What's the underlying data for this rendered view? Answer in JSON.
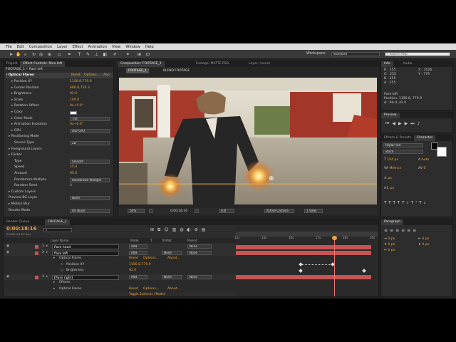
{
  "menu": [
    "File",
    "Edit",
    "Composition",
    "Layer",
    "Effect",
    "Animation",
    "View",
    "Window",
    "Help"
  ],
  "toolbar": {
    "workspace_label": "Workspace:",
    "workspace_value": "Standard",
    "search_placeholder": "Search Help"
  },
  "left_panel": {
    "tabs": [
      "Project",
      "Effect Controls: flare left"
    ],
    "breadcrumb": "FOOTAGE_1 • flare left",
    "effect_name": "Optical Flares",
    "effect_links": [
      "Reset",
      "Options...",
      "Abo"
    ],
    "properties": [
      {
        "label": "Position XY",
        "value": "1156.8,779.9",
        "indent": 2
      },
      {
        "label": "Center Position",
        "value": "668.8,759.3",
        "indent": 2
      },
      {
        "label": "Brightness",
        "value": "92.0",
        "indent": 2
      },
      {
        "label": "Scale",
        "value": "100.0",
        "indent": 2
      },
      {
        "label": "Rotation Offset",
        "value": "0x+0.0°",
        "indent": 2
      },
      {
        "label": "Color",
        "value": "",
        "indent": 2
      },
      {
        "label": "Color Mode",
        "value": "Tint",
        "indent": 2
      },
      {
        "label": "Animation Evolution",
        "value": "0x+0.0°",
        "indent": 2
      },
      {
        "label": "GPU",
        "value": "Use GPU",
        "indent": 2
      },
      {
        "label": "Positioning Mode",
        "value": "",
        "indent": 1
      },
      {
        "label": "Source Type",
        "value": "2D",
        "indent": 3
      },
      {
        "label": "Foreground Layers",
        "value": "",
        "indent": 1
      },
      {
        "label": "Flicker",
        "value": "",
        "indent": 1
      },
      {
        "label": "Type",
        "value": "Smooth",
        "indent": 3
      },
      {
        "label": "Speed",
        "value": "15.0",
        "indent": 3
      },
      {
        "label": "Amount",
        "value": "95.0",
        "indent": 3
      },
      {
        "label": "Randomize Multiple",
        "value": "Randomize Multiple",
        "indent": 3
      },
      {
        "label": "Random Seed",
        "value": "0",
        "indent": 3
      },
      {
        "label": "Custom Layers",
        "value": "",
        "indent": 1
      },
      {
        "label": "Preview BG Layer",
        "value": "None",
        "indent": 1
      },
      {
        "label": "Motion Blur",
        "value": "",
        "indent": 1
      },
      {
        "label": "Render Mode",
        "value": "On Black",
        "indent": 1
      }
    ]
  },
  "viewer": {
    "tabs": [
      "Composition: FOOTAGE_1",
      "Footage: MATTE.PSD",
      "Layer: (none)"
    ],
    "nav_crumbs": [
      "FOOTAGE_1",
      "BLEND FOOTAGE"
    ],
    "zoom": "50%",
    "timecode": "0;00;18;16",
    "resolution": "Full",
    "camera": "Active Camera",
    "views": "1 View"
  },
  "right_panel": {
    "info_tabs": [
      "Info",
      "Audio"
    ],
    "info_lines": [
      "R : 255",
      "G : 255",
      "B : 255",
      "A : 255"
    ],
    "info_coords": [
      "X : 1026",
      "Y : 779"
    ],
    "info_layer": "flare left",
    "info_position": "Position: 1156.8, 779.9",
    "info_delta": "Δ: -96.0, 42.0",
    "preview_tab": "Preview",
    "effects_tab": "Effects & Presets",
    "character_tab": "Character",
    "font_name": "Poplar Std",
    "font_style": "Black",
    "font_size": "104 px",
    "leading": "Auto",
    "tracking": "0",
    "kerning": "Metrics",
    "px_values": [
      "px",
      "px"
    ],
    "paragraph_tab": "Paragraph",
    "para_values": [
      "0 px",
      "0 px",
      "0 px",
      "0 px",
      "0 px"
    ]
  },
  "timeline": {
    "tabs": [
      "Render Queue",
      "FOOTAGE_1"
    ],
    "current_time": "0:00:18:16",
    "frame_info": "00496 (29.97 fps)",
    "columns": [
      "Layer Name",
      "Mode",
      "T",
      "TrkMat",
      "Parent"
    ],
    "rulers": [
      "12s",
      "14s",
      "16s",
      "17s",
      "18s",
      "20s"
    ],
    "toggle_label": "Toggle Switches / Modes",
    "rows": [
      {
        "num": "1",
        "name": "flare head",
        "mode": "Add",
        "trk": "",
        "parent": "None",
        "kind": "layer"
      },
      {
        "num": "2",
        "name": "flare left",
        "mode": "Add",
        "trk": "None",
        "parent": "None",
        "kind": "layer"
      },
      {
        "num": "",
        "name": "Optical Flares",
        "mode": "Reset",
        "trk": "Options...",
        "parent": "About...",
        "kind": "effect"
      },
      {
        "num": "",
        "name": "Position XY",
        "mode": "1156.8,779.9",
        "trk": "",
        "parent": "",
        "kind": "prop"
      },
      {
        "num": "",
        "name": "Brightness",
        "mode": "92.0",
        "trk": "",
        "parent": "",
        "kind": "prop"
      },
      {
        "num": "3",
        "name": "[flare right]",
        "mode": "Add",
        "trk": "None",
        "parent": "None",
        "kind": "layer"
      },
      {
        "num": "",
        "name": "Effects",
        "mode": "",
        "trk": "",
        "parent": "",
        "kind": "group"
      },
      {
        "num": "",
        "name": "Optical Flares",
        "mode": "Reset",
        "trk": "Options...",
        "parent": "About...",
        "kind": "effect"
      }
    ]
  },
  "colors": {
    "accent": "#e8a33a",
    "layer_bar": "#c65454",
    "playhead": "#ff6a6a",
    "panel": "#2d2d2d"
  }
}
